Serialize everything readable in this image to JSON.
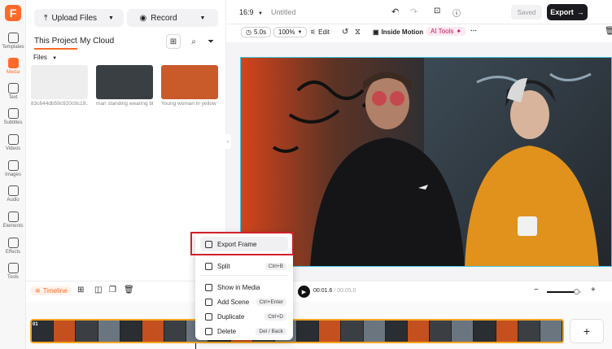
{
  "app": {
    "logo": "F"
  },
  "rail": [
    {
      "label": "Templates",
      "icon": "templates-icon"
    },
    {
      "label": "Media",
      "icon": "media-icon",
      "active": true
    },
    {
      "label": "Text",
      "icon": "text-icon"
    },
    {
      "label": "Subtitles",
      "icon": "subtitles-icon"
    },
    {
      "label": "Videos",
      "icon": "videos-icon"
    },
    {
      "label": "Images",
      "icon": "images-icon"
    },
    {
      "label": "Audio",
      "icon": "audio-icon"
    },
    {
      "label": "Elements",
      "icon": "elements-icon"
    },
    {
      "label": "Effects",
      "icon": "effects-icon"
    },
    {
      "label": "Tools",
      "icon": "tools-icon"
    }
  ],
  "panel": {
    "upload_label": "Upload Files",
    "record_label": "Record",
    "tabs": [
      "This Project",
      "My Cloud"
    ],
    "files_label": "Files",
    "files": [
      {
        "caption": "83c644db59c920c9c19...",
        "color": "#eeeeee"
      },
      {
        "caption": "man standing wearing bla...",
        "color": "#3a3f44"
      },
      {
        "caption": "Young woman in yellow w...",
        "color": "#c95a2a"
      }
    ]
  },
  "header": {
    "aspect": "16:9",
    "title": "Untitled",
    "saved_label": "Saved",
    "export_label": "Export"
  },
  "toolbar": {
    "duration": "5.0s",
    "zoom": "100%",
    "edit_label": "Edit",
    "inside_motion_label": "Inside Motion",
    "ai_tools_label": "AI Tools"
  },
  "timeline": {
    "label": "Timeline",
    "current_time": "00:01.6",
    "total_time": "00:05.0",
    "clip_index": "01",
    "clip_count": 24,
    "zoom_level": 0.85
  },
  "menu": [
    {
      "label": "Export Frame",
      "shortcut": "",
      "icon": "export-frame-icon",
      "highlight": true
    },
    {
      "label": "Split",
      "shortcut": "Ctrl+B",
      "icon": "split-icon"
    },
    {
      "label": "Show in Media",
      "shortcut": "",
      "icon": "show-in-media-icon"
    },
    {
      "label": "Add Scene",
      "shortcut": "Ctrl+Enter",
      "icon": "add-scene-icon"
    },
    {
      "label": "Duplicate",
      "shortcut": "Ctrl+D",
      "icon": "duplicate-icon"
    },
    {
      "label": "Delete",
      "shortcut": "Del / Back",
      "icon": "delete-icon"
    }
  ],
  "colors": {
    "accent": "#ff6a2b",
    "highlight_border": "#d0202a",
    "clip_border": "#f5a623",
    "selection": "#46c7e0"
  }
}
